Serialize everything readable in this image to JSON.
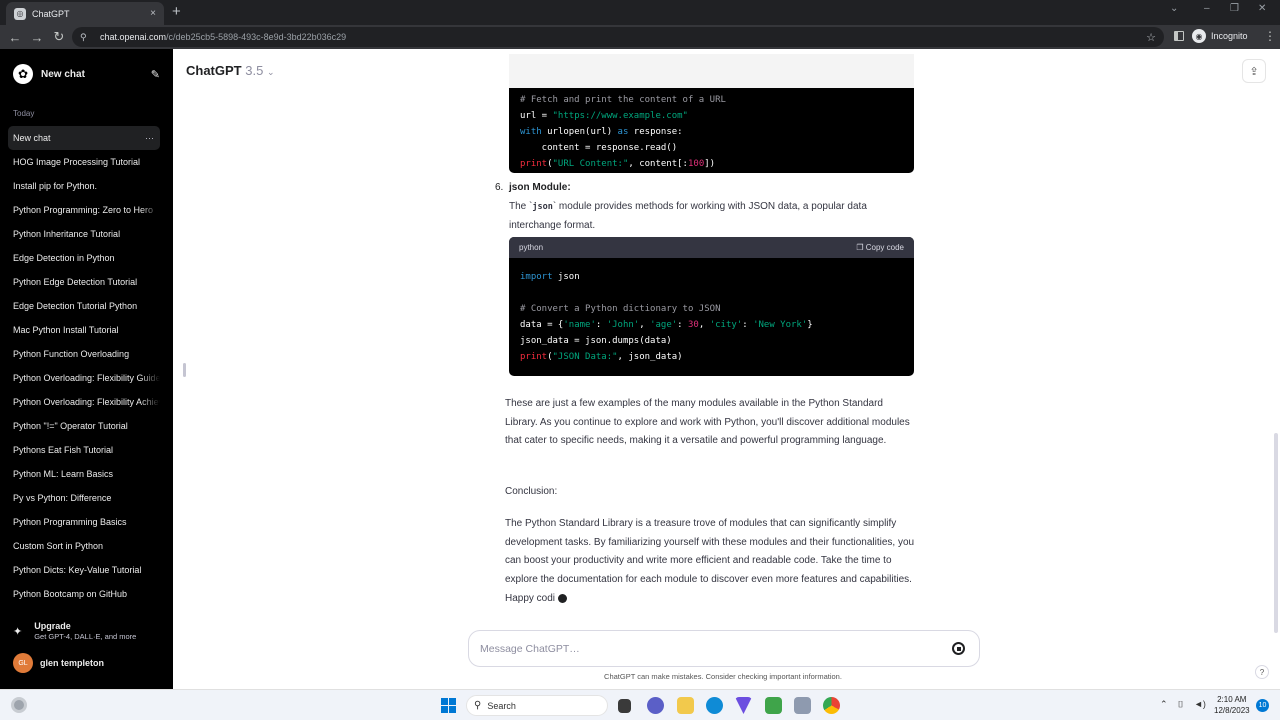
{
  "browser": {
    "tab_title": "ChatGPT",
    "tab_close": "×",
    "new_tab": "+",
    "url_domain": "chat.openai.com",
    "url_path": "/c/deb25cb5-5898-493c-8e9d-3bd22b036c29",
    "incognito_label": "Incognito"
  },
  "sidebar": {
    "new_chat_label": "New chat",
    "section_label": "Today",
    "items": [
      {
        "label": "New chat"
      },
      {
        "label": "HOG Image Processing Tutorial"
      },
      {
        "label": "Install pip for Python."
      },
      {
        "label": "Python Programming: Zero to Hero"
      },
      {
        "label": "Python Inheritance Tutorial"
      },
      {
        "label": "Edge Detection in Python"
      },
      {
        "label": "Python Edge Detection Tutorial"
      },
      {
        "label": "Edge Detection Tutorial Python"
      },
      {
        "label": "Mac Python Install Tutorial"
      },
      {
        "label": "Python Function Overloading"
      },
      {
        "label": "Python Overloading: Flexibility Guide"
      },
      {
        "label": "Python Overloading: Flexibility Achieved"
      },
      {
        "label": "Python \"!=\" Operator Tutorial"
      },
      {
        "label": "Pythons Eat Fish Tutorial"
      },
      {
        "label": "Python ML: Learn Basics"
      },
      {
        "label": "Py vs Python: Difference"
      },
      {
        "label": "Python Programming Basics"
      },
      {
        "label": "Custom Sort in Python"
      },
      {
        "label": "Python Dicts: Key-Value Tutorial"
      },
      {
        "label": "Python Bootcamp on GitHub"
      }
    ],
    "upgrade_title": "Upgrade",
    "upgrade_subtitle": "Get GPT-4, DALL·E, and more",
    "user_initials": "GL",
    "user_name": "glen templeton"
  },
  "header": {
    "model_name": "ChatGPT",
    "model_version": "3.5"
  },
  "content": {
    "urllib_code": [
      "# Fetch and print the content of a URL",
      "url = \"https://www.example.com\"",
      "with urlopen(url) as response:",
      "    content = response.read()",
      "print(\"URL Content:\", content[:100])"
    ],
    "item_number": "6.",
    "item_title": "json Module:",
    "item_desc_pre": "The `",
    "item_desc_code": "json",
    "item_desc_post": "` module provides methods for working with JSON data, a popular data interchange format.",
    "code_lang": "python",
    "copy_label": "Copy code",
    "json_code": [
      "import json",
      "",
      "# Convert a Python dictionary to JSON",
      "data = {'name': 'John', 'age': 30, 'city': 'New York'}",
      "json_data = json.dumps(data)",
      "print(\"JSON Data:\", json_data)"
    ],
    "para1": "These are just a few examples of the many modules available in the Python Standard Library. As you continue to explore and work with Python, you'll discover additional modules that cater to specific needs, making it a versatile and powerful programming language.",
    "conclusion_label": "Conclusion:",
    "para2": "The Python Standard Library is a treasure trove of modules that can significantly simplify development tasks. By familiarizing yourself with these modules and their functionalities, you can boost your productivity and write more efficient and readable code. Take the time to explore the documentation for each module to discover even more features and capabilities. Happy codi"
  },
  "composer": {
    "placeholder": "Message ChatGPT…",
    "disclaimer": "ChatGPT can make mistakes. Consider checking important information.",
    "help": "?"
  },
  "taskbar": {
    "search_label": "Search",
    "time": "2:10 AM",
    "date": "12/8/2023",
    "notifications": "10"
  },
  "colors": {
    "sidebar_bg": "#000000",
    "code_bg": "#000000",
    "keyword": "#2e95d3",
    "string": "#00a67d",
    "number": "#df3079"
  }
}
